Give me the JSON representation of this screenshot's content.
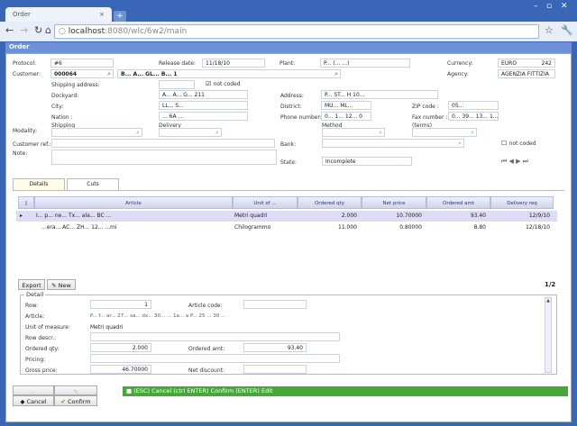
{
  "browser": {
    "tab_title": "Order",
    "url_host": "localhost",
    "url_path": ":8080/wlc/6w2/main"
  },
  "window": {
    "title": "Order"
  },
  "header": {
    "protocol_label": "Protocol:",
    "protocol": "#6",
    "release_label": "Release date:",
    "release_date": "11/18/10",
    "plant_label": "Plant:",
    "plant": "P... (... ...)",
    "currency_label": "Currency:",
    "currency": "EURO",
    "currency_code": "242",
    "agency_label": "Agency:",
    "agency": "AGENZIA FITTIZIA",
    "customer_label": "Customer:",
    "customer_code": "000064",
    "customer_name": "B... A... GL... B... 1",
    "shipping_address_label": "Shipping address:",
    "not_coded_label": "not coded",
    "dockyard_label": "Dockyard:",
    "dockyard": "A... A... G... 211",
    "city_label": "City:",
    "city": "LL... S...",
    "nation_label": "Nation :",
    "nation": "... 6A ...",
    "address_label": "Address:",
    "address": "P... ST... H 10...",
    "district_label": "District:",
    "district": "MU... ML...",
    "zip_label": "ZIP code :",
    "zip": "05...",
    "phone_label": "Phone number:",
    "phone": "0... 1... 12... 0",
    "fax_label": "Fax number :",
    "fax": "0... 39... 13... 1...",
    "modality_label": "Modality:",
    "shipping_label": "Shipping",
    "delivery_label": "Delivery",
    "method_label": "Method",
    "terms_label": "(terms)",
    "customer_ref_label": "Customer ref.:",
    "bank_label": "Bank:",
    "bank_not_coded_label": "not coded",
    "note_label": "Note:",
    "state_label": "State:",
    "state": "Incomplete"
  },
  "tabs": [
    {
      "label": "Details"
    },
    {
      "label": "Cuts"
    }
  ],
  "grid": {
    "columns": [
      "Article",
      "Unit of ...",
      "Ordered qty",
      "Net price",
      "Ordered amt",
      "Delivery req"
    ],
    "rows": [
      {
        "article": "I... p... ne... Tx... ala... BC ...",
        "unit": "Metri quadri",
        "qty": "2.000",
        "price": "10.70000",
        "amt": "93.40",
        "delivery": "12/9/10"
      },
      {
        "article": "...era... AC... ZH... 12... ...mi",
        "unit": "Chilogrammo",
        "qty": "11.000",
        "price": "0.80000",
        "amt": "8.80",
        "delivery": "12/18/10"
      }
    ]
  },
  "grid_toolbar": {
    "export": "Export",
    "new": "New",
    "page": "1/2"
  },
  "detail": {
    "legend": "Detail",
    "row_label": "Row:",
    "row": "1",
    "article_code_label": "Article code:",
    "article_label": "Article:",
    "article": "P... f... ar... 27... sa... dx... 30... ... 1a... a P... 25 ... 30 ...",
    "uom_label": "Unit of measure:",
    "uom": "Metri quadri",
    "row_descr_label": "Row descr.:",
    "ordered_qty_label": "Ordered qty:",
    "ordered_qty": "2.000",
    "ordered_amt_label": "Ordered amt:",
    "ordered_amt": "93.40",
    "pricing_label": "Pricing:",
    "gross_price_label": "Gross price:",
    "gross_price": "46.70000",
    "net_discount_label": "Net discount:"
  },
  "footer": {
    "cancel": "Cancel",
    "confirm": "Confirm",
    "hint": "(ESC) Cancel  (ctrl ENTER) Confirm  (ENTER) Edit"
  }
}
